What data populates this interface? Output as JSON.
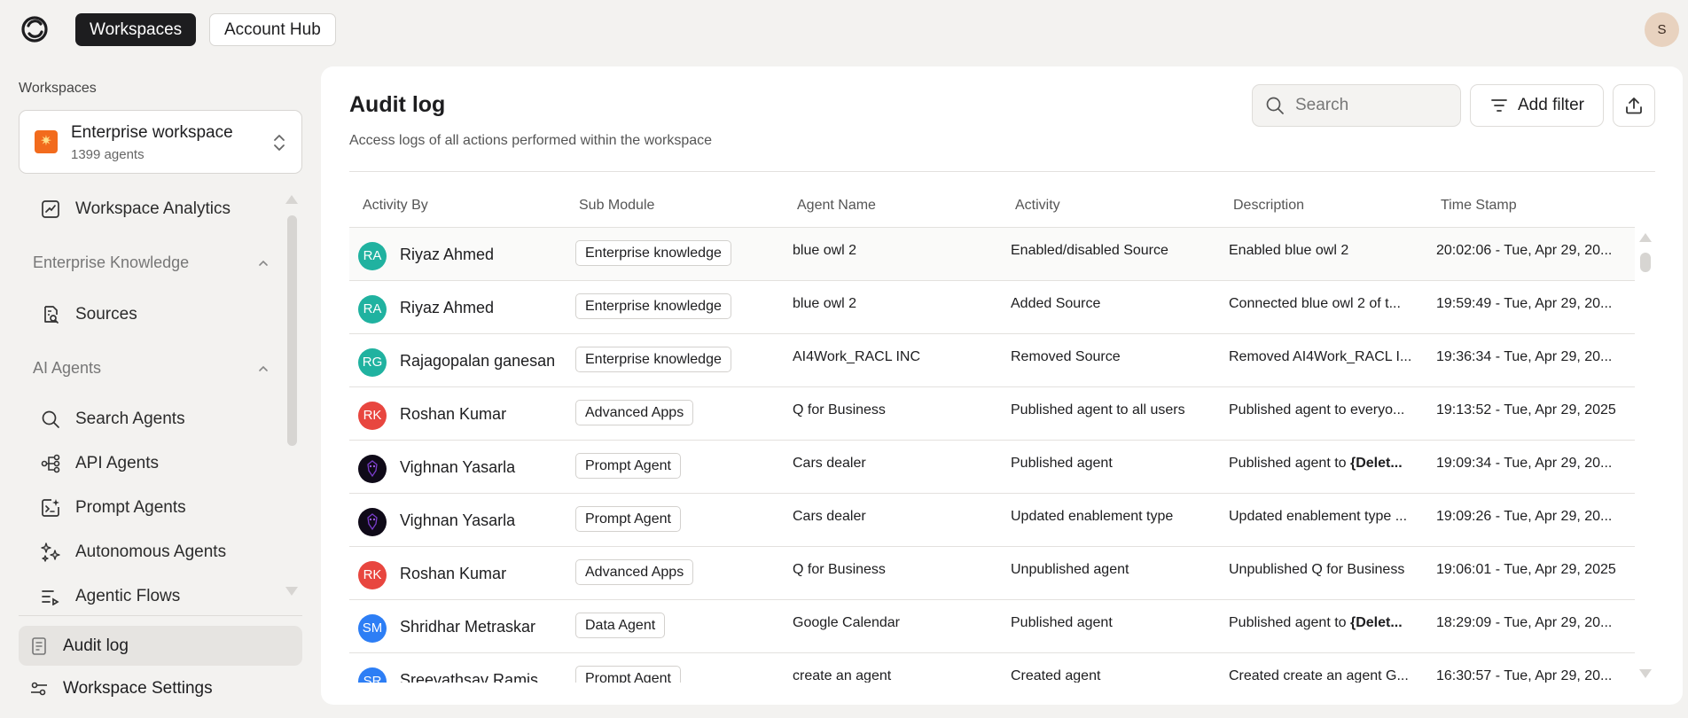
{
  "topbar": {
    "tabs": [
      {
        "label": "Workspaces",
        "active": true
      },
      {
        "label": "Account Hub",
        "active": false
      }
    ],
    "user_initial": "S"
  },
  "sidebar": {
    "section_title": "Workspaces",
    "workspace": {
      "name": "Enterprise workspace",
      "count": "1399 agents"
    },
    "items": [
      {
        "label": "Workspace Analytics",
        "icon": "chart-icon"
      },
      {
        "label": "Sources",
        "icon": "document-search-icon"
      },
      {
        "label": "Search Agents",
        "icon": "search-icon"
      },
      {
        "label": "API Agents",
        "icon": "api-icon"
      },
      {
        "label": "Prompt Agents",
        "icon": "prompt-icon"
      },
      {
        "label": "Autonomous Agents",
        "icon": "sparkles-icon"
      },
      {
        "label": "Agentic Flows",
        "icon": "flow-icon"
      }
    ],
    "groups": [
      {
        "label": "Enterprise Knowledge"
      },
      {
        "label": "AI Agents"
      }
    ],
    "audit_log": "Audit log",
    "settings": "Workspace Settings"
  },
  "main": {
    "title": "Audit log",
    "subtitle": "Access logs of all actions performed within the workspace",
    "search_placeholder": "Search",
    "add_filter": "Add filter",
    "columns": [
      "Activity By",
      "Sub Module",
      "Agent Name",
      "Activity",
      "Description",
      "Time Stamp"
    ],
    "rows": [
      {
        "initials": "RA",
        "color": "#20b2a0",
        "user": "Riyaz Ahmed",
        "module": "Enterprise knowledge",
        "agent": "blue owl 2",
        "activity": "Enabled/disabled Source",
        "desc": "Enabled blue owl 2",
        "desc_bold": "",
        "time": "20:02:06 - Tue, Apr 29, 20..."
      },
      {
        "initials": "RA",
        "color": "#20b2a0",
        "user": "Riyaz Ahmed",
        "module": "Enterprise knowledge",
        "agent": "blue owl 2",
        "activity": "Added Source",
        "desc": "Connected blue owl 2 of t...",
        "desc_bold": "",
        "time": "19:59:49 - Tue, Apr 29, 20..."
      },
      {
        "initials": "RG",
        "color": "#20b2a0",
        "user": "Rajagopalan ganesan",
        "module": "Enterprise knowledge",
        "agent": "AI4Work_RACL INC",
        "activity": "Removed Source",
        "desc": "Removed AI4Work_RACL I...",
        "desc_bold": "",
        "time": "19:36:34 - Tue, Apr 29, 20..."
      },
      {
        "initials": "RK",
        "color": "#e8463f",
        "user": "Roshan Kumar",
        "module": "Advanced Apps",
        "agent": "Q for Business",
        "activity": "Published agent to all users",
        "desc": "Published agent to everyo...",
        "desc_bold": "",
        "time": "19:13:52 - Tue, Apr 29, 2025"
      },
      {
        "initials": "",
        "color": "#0f0a18",
        "user": "Vighnan Yasarla",
        "module": "Prompt Agent",
        "agent": "Cars dealer",
        "activity": "Published agent",
        "desc": "Published agent to ",
        "desc_bold": "{Delet...",
        "time": "19:09:34 - Tue, Apr 29, 20..."
      },
      {
        "initials": "",
        "color": "#0f0a18",
        "user": "Vighnan Yasarla",
        "module": "Prompt Agent",
        "agent": "Cars dealer",
        "activity": "Updated enablement type",
        "desc": "Updated enablement type ...",
        "desc_bold": "",
        "time": "19:09:26 - Tue, Apr 29, 20..."
      },
      {
        "initials": "RK",
        "color": "#e8463f",
        "user": "Roshan Kumar",
        "module": "Advanced Apps",
        "agent": "Q for Business",
        "activity": "Unpublished agent",
        "desc": "Unpublished Q for Business",
        "desc_bold": "",
        "time": "19:06:01 - Tue, Apr 29, 2025"
      },
      {
        "initials": "SM",
        "color": "#2d7ef5",
        "user": "Shridhar Metraskar",
        "module": "Data Agent",
        "agent": "Google Calendar",
        "activity": "Published agent",
        "desc": "Published agent to ",
        "desc_bold": "{Delet...",
        "time": "18:29:09 - Tue, Apr 29, 20..."
      },
      {
        "initials": "SR",
        "color": "#2d7ef5",
        "user": "Sreevathsav Ramis",
        "module": "Prompt Agent",
        "agent": "create an agent",
        "activity": "Created agent",
        "desc": "Created create an agent G...",
        "desc_bold": "",
        "time": "16:30:57 - Tue, Apr 29, 20..."
      }
    ]
  }
}
